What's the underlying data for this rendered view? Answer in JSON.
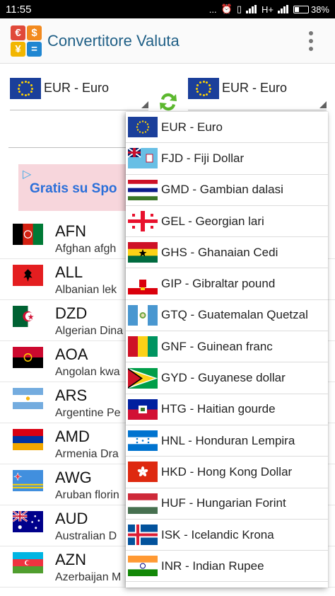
{
  "status_bar": {
    "time": "11:55",
    "dots": "...",
    "network": "H+",
    "battery": "38%"
  },
  "app_bar": {
    "title": "Convertitore Valuta",
    "logo_symbols": [
      "€",
      "$",
      "¥",
      "="
    ],
    "logo_colors": [
      "#e0493a",
      "#f28a1f",
      "#f2b600",
      "#1f86d1"
    ]
  },
  "converter": {
    "from": "EUR - Euro",
    "to": "EUR - Euro"
  },
  "ad": {
    "text": "Gratis su Spo"
  },
  "currency_list": [
    {
      "code": "AFN",
      "name": "Afghan afgh"
    },
    {
      "code": "ALL",
      "name": "Albanian lek"
    },
    {
      "code": "DZD",
      "name": "Algerian Dina"
    },
    {
      "code": "AOA",
      "name": "Angolan kwa"
    },
    {
      "code": "ARS",
      "name": "Argentine Pe"
    },
    {
      "code": "AMD",
      "name": "Armenia Dra"
    },
    {
      "code": "AWG",
      "name": "Aruban florin"
    },
    {
      "code": "AUD",
      "name": "Australian D"
    },
    {
      "code": "AZN",
      "name": "Azerbaijan M"
    }
  ],
  "dropdown_options": [
    {
      "label": "EUR - Euro"
    },
    {
      "label": "FJD - Fiji Dollar"
    },
    {
      "label": "GMD - Gambian dalasi"
    },
    {
      "label": "GEL - Georgian lari"
    },
    {
      "label": "GHS - Ghanaian Cedi"
    },
    {
      "label": "GIP - Gibraltar pound"
    },
    {
      "label": "GTQ - Guatemalan Quetzal"
    },
    {
      "label": "GNF - Guinean franc"
    },
    {
      "label": "GYD - Guyanese dollar"
    },
    {
      "label": "HTG - Haitian gourde"
    },
    {
      "label": "HNL - Honduran Lempira"
    },
    {
      "label": "HKD - Hong Kong Dollar"
    },
    {
      "label": "HUF - Hungarian Forint"
    },
    {
      "label": "ISK - Icelandic Krona"
    },
    {
      "label": "INR - Indian Rupee"
    }
  ]
}
